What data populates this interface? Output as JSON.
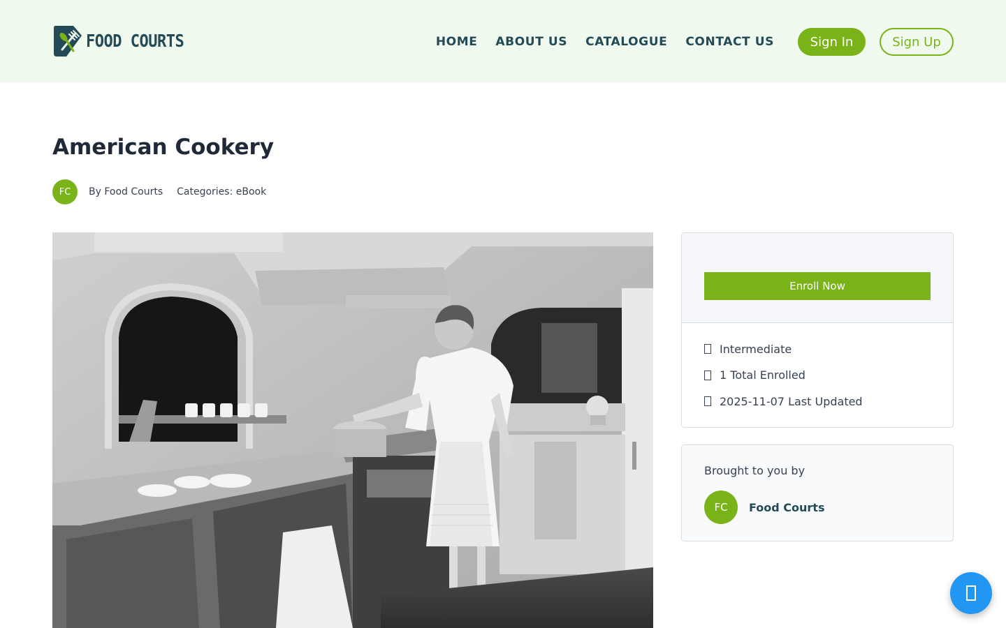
{
  "header": {
    "logo_text": "FOOD COURTS",
    "nav": [
      "HOME",
      "ABOUT US",
      "CATALOGUE",
      "CONTACT US"
    ],
    "signin_label": "Sign In",
    "signup_label": "Sign Up"
  },
  "course": {
    "title": "American Cookery",
    "author_initials": "FC",
    "by_line": "By Food Courts",
    "categories": "Categories: eBook"
  },
  "sidebar": {
    "enroll_label": "Enroll Now",
    "info": [
      {
        "icon": "level-icon",
        "text": "Intermediate"
      },
      {
        "icon": "enrolled-icon",
        "text": "1 Total Enrolled"
      },
      {
        "icon": "updated-icon",
        "text": "2025-11-07 Last Updated"
      }
    ],
    "brought_label": "Brought to you by",
    "author_initials": "FC",
    "author_name": "Food Courts"
  },
  "colors": {
    "brand_green": "#7ab317",
    "header_bg": "#f0f9ee",
    "nav_text": "#234a57",
    "chat_blue": "#2196f3"
  },
  "hero_image": {
    "description_icon": "kitchen-photo"
  },
  "chat": {
    "icon": "chat-icon"
  }
}
